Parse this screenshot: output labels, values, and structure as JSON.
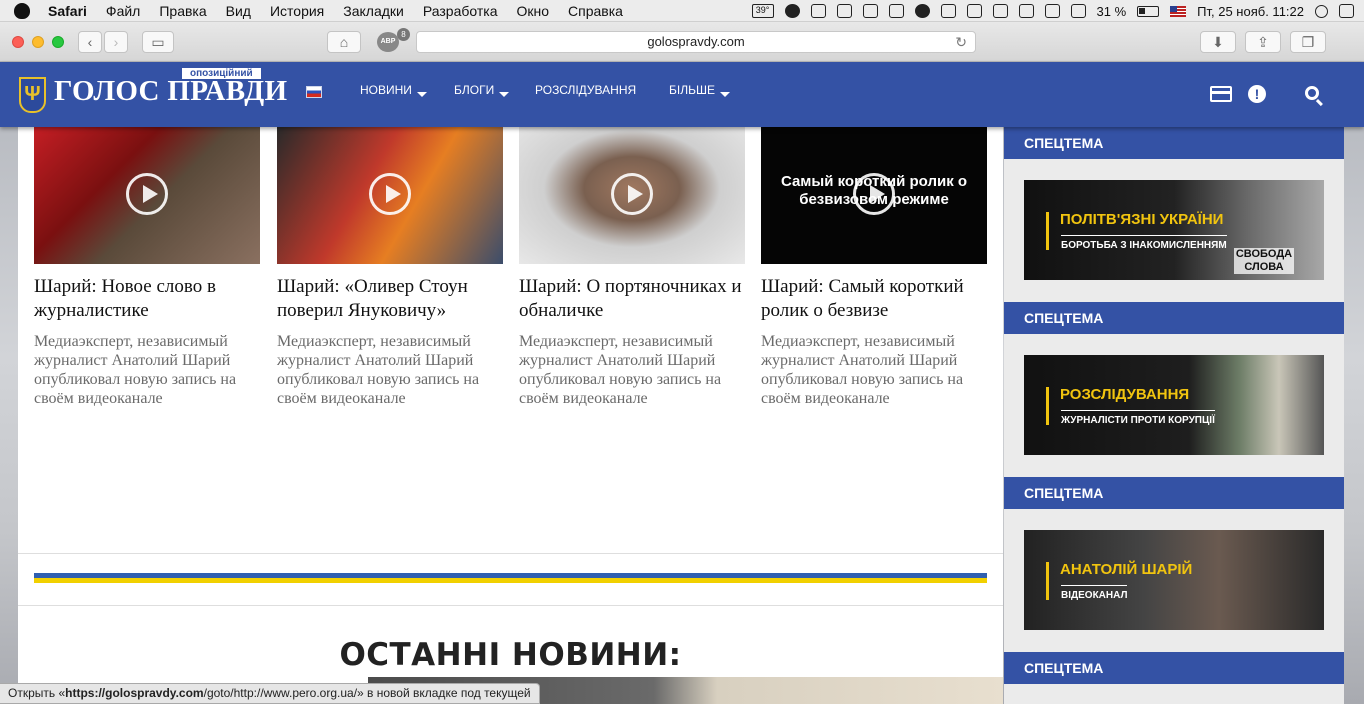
{
  "menubar": {
    "app": "Safari",
    "items": [
      "Файл",
      "Правка",
      "Вид",
      "История",
      "Закладки",
      "Разработка",
      "Окно",
      "Справка"
    ],
    "temp": "39°",
    "battery": "31 %",
    "datetime": "Пт, 25 нояб. 11:22"
  },
  "browser": {
    "url": "golospravdy.com",
    "abp_label": "ABP",
    "abp_count": "8"
  },
  "site": {
    "logo_tag": "опозиційний",
    "logo_title": "ГОЛОС ПРАВДИ",
    "nav": [
      "НОВИНИ",
      "БЛОГИ",
      "РОЗСЛІДУВАННЯ",
      "БІЛЬШЕ"
    ]
  },
  "cards": [
    {
      "title": "Шарий: Новое слово в журналистике",
      "desc": "Медиаэксперт, независимый журналист Анатолий Шарий опубликовал новую запись на своём видеоканале",
      "caption": ""
    },
    {
      "title": "Шарий: «Оливер Стоун поверил Януковичу»",
      "desc": "Медиаэксперт, независимый журналист Анатолий Шарий опубликовал новую запись на своём видеоканале",
      "caption": ""
    },
    {
      "title": "Шарий: О портяночниках и обналичке",
      "desc": "Медиаэксперт, независимый журналист Анатолий Шарий опубликовал новую запись на своём видеоканале",
      "caption": ""
    },
    {
      "title": "Шарий: Самый короткий ролик о безвизе",
      "desc": "Медиаэксперт, независимый журналист Анатолий Шарий опубликовал новую запись на своём видеоканале",
      "caption": "Самый короткий ролик о безвизовом режиме"
    }
  ],
  "latest_heading": "ОСТАННІ НОВИНИ:",
  "sidebar": {
    "heads": [
      "СПЕЦТЕМА",
      "СПЕЦТЕМА",
      "СПЕЦТЕМА",
      "СПЕЦТЕМА"
    ],
    "banners": [
      {
        "title": "ПОЛІТВ'ЯЗНІ УКРАЇНИ",
        "subtitle": "БОРОТЬБА З ІНАКОМИСЛЕННЯМ",
        "extra": "СВОБОДА СЛОВА"
      },
      {
        "title": "РОЗСЛІДУВАННЯ",
        "subtitle": "ЖУРНАЛІСТИ ПРОТИ КОРУПЦІЇ",
        "extra": ""
      },
      {
        "title": "АНАТОЛІЙ ШАРІЙ",
        "subtitle": "ВІДЕОКАНАЛ",
        "extra": ""
      }
    ]
  },
  "status": {
    "prefix": "Открыть «",
    "link": "https://golospravdy.com",
    "rest": "/goto/http://www.pero.org.ua/» в новой вкладке под текущей"
  },
  "colors": {
    "brand_blue": "#3452a5",
    "accent_yellow": "#f1c40f"
  }
}
